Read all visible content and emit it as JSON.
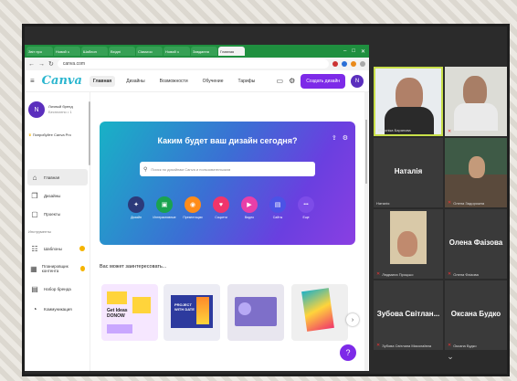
{
  "browser": {
    "tabs": [
      "Звіт про",
      "Новий з",
      "Шаблон",
      "Вхідні",
      "Classroo",
      "Новий з",
      "Завдання",
      "Главная"
    ],
    "url": "canva.com"
  },
  "canva": {
    "logo": "Canva",
    "nav": [
      "Главная",
      "Дизайны",
      "Возможности",
      "Обучение",
      "Тарифы"
    ],
    "create_label": "Создать дизайн",
    "avatar": "N",
    "team_avatar": "N",
    "team_name": "Личный бренд",
    "team_sub": "Бесплатно • 1",
    "pro_label": "Попробуйте Canva Pro",
    "sidebar": [
      "Главная",
      "Дизайны",
      "Проекты"
    ],
    "sidebar_section": "Инструменты",
    "sidebar_tools": [
      "Шаблоны",
      "Планировщик контента",
      "Набор бренда",
      "Коммуникация"
    ],
    "hero_title": "Каким будет ваш дизайн сегодня?",
    "search_placeholder": "Поиск по дизайнам Canva и пользовательским",
    "categories": [
      {
        "label": "Дизайн",
        "icon": "✦"
      },
      {
        "label": "Интерактивные",
        "icon": "▣"
      },
      {
        "label": "Презентации",
        "icon": "◉"
      },
      {
        "label": "Соцсети",
        "icon": "♥"
      },
      {
        "label": "Видео",
        "icon": "▶"
      },
      {
        "label": "Сайты",
        "icon": "▤"
      },
      {
        "label": "Еще",
        "icon": "•••"
      }
    ],
    "suggestions_title": "Вас может заинтересовать...",
    "card1_text": "Get Ideas DONOW",
    "card2_text": "PROJECT WITH DATE"
  },
  "participants": [
    {
      "name": "Вероніка Баранова"
    },
    {
      "name": "Ірина Позначарчук"
    },
    {
      "name": "Наталія",
      "big": "Наталія"
    },
    {
      "name": "Олена Задорожна"
    },
    {
      "name": "Людмила Процько"
    },
    {
      "name": "Олена Фаізова",
      "big": "Олена Фаізова"
    },
    {
      "name": "Зубова Світлана Миколаївна",
      "big": "Зубова Світлан..."
    },
    {
      "name": "Оксана Будко",
      "big": "Оксана Будко"
    }
  ]
}
